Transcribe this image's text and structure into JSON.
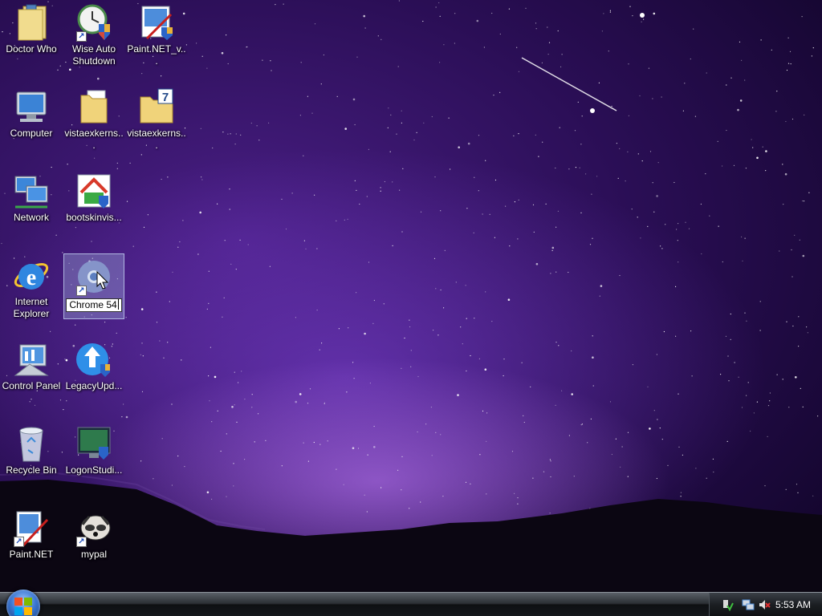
{
  "desktop": {
    "icons": [
      {
        "label": "Doctor Who",
        "icon": "folder-icon"
      },
      {
        "label": "Wise Auto Shutdown",
        "icon": "clock-shield-icon"
      },
      {
        "label": "Paint.NET_v...",
        "icon": "installer-icon"
      },
      {
        "label": "Computer",
        "icon": "computer-icon"
      },
      {
        "label": "vistaexkerns...",
        "icon": "folder-icon"
      },
      {
        "label": "vistaexkerns...",
        "icon": "zip-folder-icon"
      },
      {
        "label": "Network",
        "icon": "network-icon"
      },
      {
        "label": "bootskinvis...",
        "icon": "installer-house-icon"
      },
      {
        "label": "Internet Explorer",
        "icon": "ie-icon"
      },
      {
        "label": "Chrome 54",
        "icon": "chrome-icon"
      },
      {
        "label": "Control Panel",
        "icon": "control-panel-icon"
      },
      {
        "label": "LegacyUpd...",
        "icon": "update-icon"
      },
      {
        "label": "Recycle Bin",
        "icon": "recycle-bin-icon"
      },
      {
        "label": "LogonStudi...",
        "icon": "monitor-icon"
      },
      {
        "label": "Paint.NET",
        "icon": "paint-icon"
      },
      {
        "label": "mypal",
        "icon": "raccoon-icon"
      }
    ]
  },
  "taskbar": {
    "clock": "5:53 AM",
    "tray_icons": [
      "safely-remove-icon",
      "network-icon",
      "volume-muted-icon"
    ]
  },
  "colors": {
    "sky_top": "#14062e",
    "sky_glow": "#8a46dc",
    "taskbar": "#16191d"
  }
}
